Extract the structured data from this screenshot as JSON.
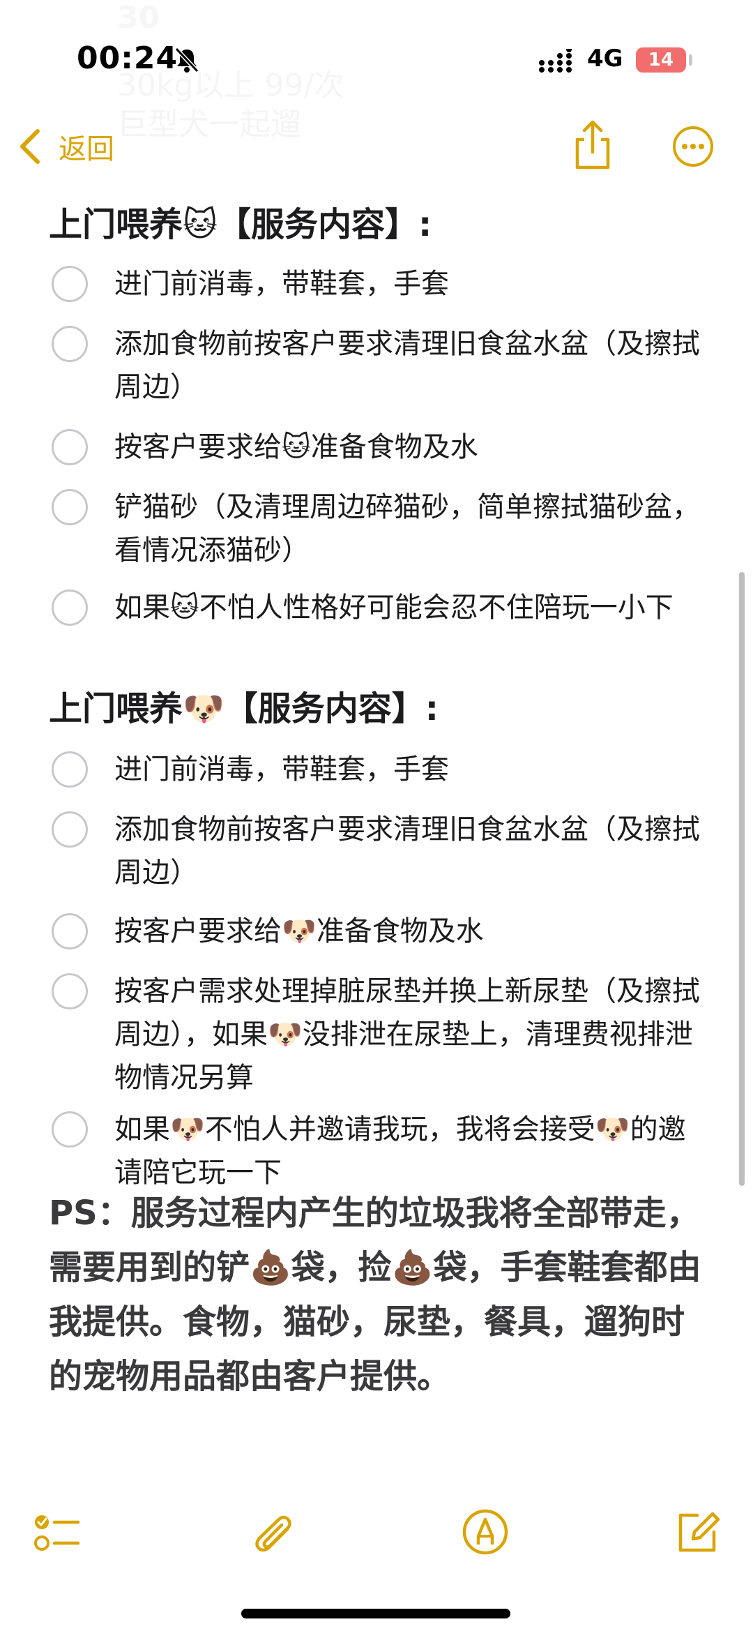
{
  "status_bar": {
    "time": "00:24",
    "network": "4G",
    "battery": "14"
  },
  "nav": {
    "back_label": "返回"
  },
  "background_ghost": {
    "line1": "30",
    "line2": "30kg以上 99/次",
    "line3": "巨型犬一起遛"
  },
  "cat_section": {
    "title": "上门喂养🐱【服务内容】:",
    "items": [
      {
        "text": "进门前消毒，带鞋套，手套"
      },
      {
        "text": "添加食物前按客户要求清理旧食盆水盆（及擦拭周边）"
      },
      {
        "text": "按客户要求给🐱准备食物及水"
      },
      {
        "text": "铲猫砂（及清理周边碎猫砂，简单擦拭猫砂盆，看情况添猫砂）"
      },
      {
        "text": "如果🐱不怕人性格好可能会忍不住陪玩一小下"
      }
    ]
  },
  "dog_section": {
    "title": "上门喂养🐶【服务内容】:",
    "items": [
      {
        "text": "进门前消毒，带鞋套，手套"
      },
      {
        "text": "添加食物前按客户要求清理旧食盆水盆（及擦拭周边）"
      },
      {
        "text": "按客户要求给🐶准备食物及水"
      },
      {
        "text": "按客户需求处理掉脏尿垫并换上新尿垫（及擦拭周边），如果🐶没排泄在尿垫上，清理费视排泄物情况另算"
      },
      {
        "text": "如果🐶不怕人并邀请我玩，我将会接受🐶的邀请陪它玩一下"
      }
    ]
  },
  "ps_note": "PS：服务过程内产生的垃圾我将全部带走，需要用到的铲💩袋，捡💩袋，手套鞋套都由我提供。食物，猫砂，尿垫，餐具，遛狗时的宠物用品都由客户提供。",
  "toolbar": {
    "icons": [
      "checklist-icon",
      "attachment-icon",
      "markup-icon",
      "compose-icon"
    ]
  },
  "colors": {
    "accent": "#d9a400",
    "checkbox_border": "#c7c7cc",
    "battery_low": "#f26d6d",
    "text": "#1c1c1e"
  }
}
